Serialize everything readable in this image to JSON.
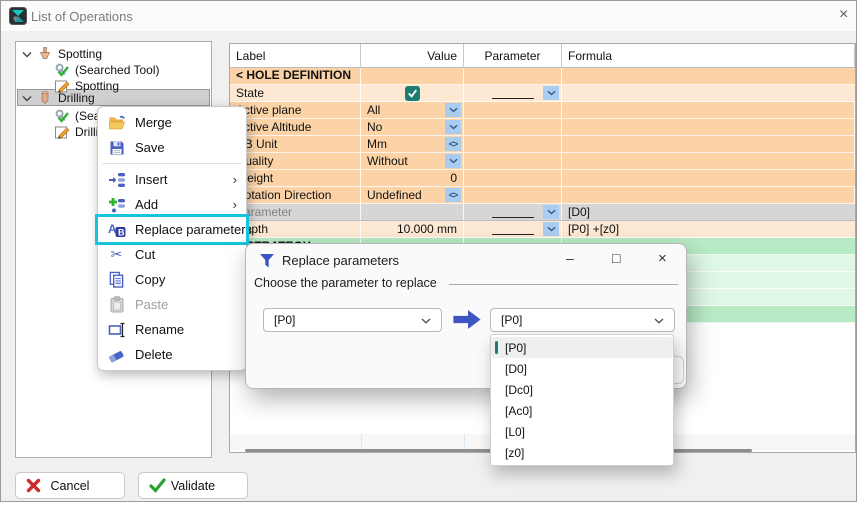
{
  "window": {
    "title": "List of Operations",
    "close": "×"
  },
  "tree": {
    "items": [
      {
        "label": "Spotting"
      },
      {
        "label": "(Searched Tool)"
      },
      {
        "label": "Spotting"
      },
      {
        "label": "Drilling"
      },
      {
        "label": "(Searched Tool)"
      },
      {
        "label": "Drilling"
      }
    ]
  },
  "menu": {
    "items": [
      {
        "label": "Merge"
      },
      {
        "label": "Save"
      },
      {
        "label": "Insert"
      },
      {
        "label": "Add"
      },
      {
        "label": "Replace parameters"
      },
      {
        "label": "Cut"
      },
      {
        "label": "Copy"
      },
      {
        "label": "Paste"
      },
      {
        "label": "Rename"
      },
      {
        "label": "Delete"
      }
    ],
    "submenu_arrow": "›"
  },
  "table": {
    "headers": [
      "Label",
      "Value",
      "Parameter",
      "Formula"
    ],
    "rows": [
      {
        "label": "< HOLE DEFINITION >"
      },
      {
        "label": "State"
      },
      {
        "label": "Active plane",
        "value": "All"
      },
      {
        "label": "Active Altitude",
        "value": "No"
      },
      {
        "label": "DB Unit",
        "value": "Mm"
      },
      {
        "label": "Quality",
        "value": "Without"
      },
      {
        "label": "Weight",
        "value": "0"
      },
      {
        "label": "Rotation Direction",
        "value": "Undefined"
      },
      {
        "label": "Parameter",
        "formula": "[D0]"
      },
      {
        "label": "Depth",
        "value": "10.000 mm",
        "formula": "[P0] +[z0]"
      },
      {
        "label": "< STRATEGY >"
      }
    ]
  },
  "dialog": {
    "title": "Replace parameters",
    "group_label": "Choose the parameter to replace",
    "combo_from": "[P0]",
    "combo_to": "[P0]",
    "options": [
      "[P0]",
      "[D0]",
      "[Dc0]",
      "[Ac0]",
      "[L0]",
      "[z0]"
    ],
    "minimize": "–",
    "maximize": "□",
    "close": "×"
  },
  "footer": {
    "cancel": "Cancel",
    "validate": "Validate"
  },
  "icons": {
    "spinner": "<>",
    "cut": "✂"
  },
  "colors": {
    "accent_cyan": "#17c3dc",
    "peach": "#fbd3a6",
    "peach_light": "#fde9d3",
    "green_mid": "#b7ebc5",
    "green_light": "#def7e6",
    "teal_check": "#1e7d72",
    "blue_icon": "#4a5fc1"
  }
}
